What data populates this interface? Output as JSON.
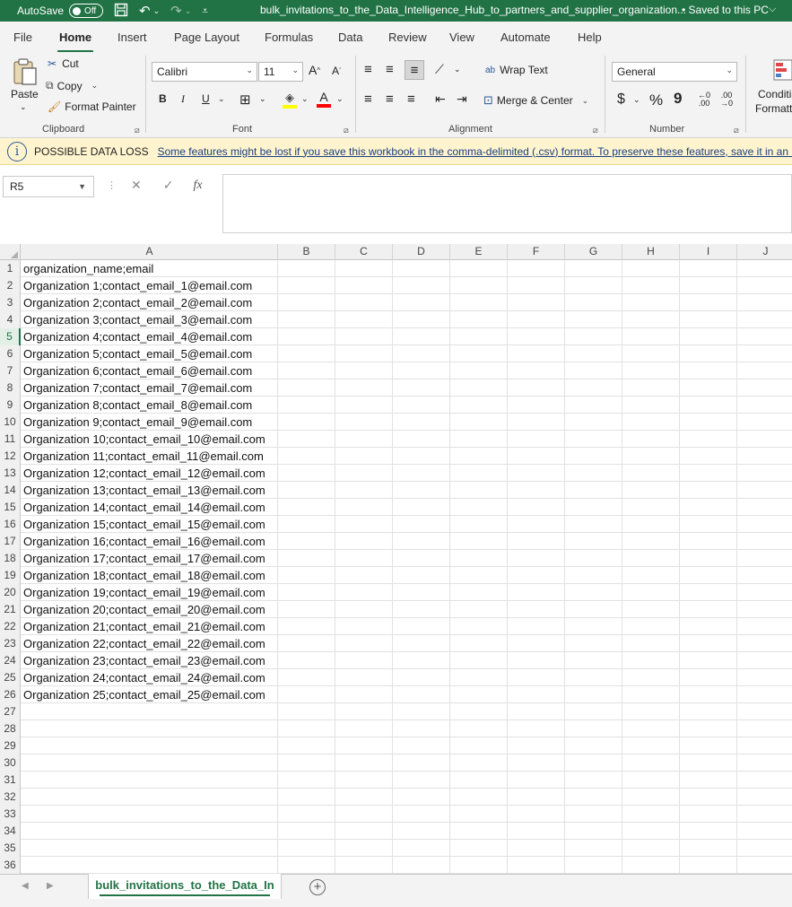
{
  "titlebar": {
    "autosave_label": "AutoSave",
    "autosave_state": "Off",
    "document_title": "bulk_invitations_to_the_Data_Intelligence_Hub_to_partners_and_supplier_organization...",
    "save_status": "• Saved to this PC"
  },
  "menu": {
    "tabs": [
      "File",
      "Home",
      "Insert",
      "Page Layout",
      "Formulas",
      "Data",
      "Review",
      "View",
      "Automate",
      "Help"
    ],
    "active": "Home"
  },
  "ribbon": {
    "clipboard": {
      "paste": "Paste",
      "cut": "Cut",
      "copy": "Copy",
      "format_painter": "Format Painter",
      "label": "Clipboard"
    },
    "font": {
      "family": "Calibri",
      "size": "11",
      "bold": "B",
      "italic": "I",
      "underline": "U",
      "label": "Font"
    },
    "alignment": {
      "wrap_text": "Wrap Text",
      "merge_center": "Merge & Center",
      "label": "Alignment"
    },
    "number": {
      "format": "General",
      "currency": "$",
      "percent": "%",
      "comma": "9",
      "label": "Number"
    },
    "styles": {
      "conditional_line1": "Conditi",
      "conditional_line2": "Formatt"
    }
  },
  "infobar": {
    "title": "POSSIBLE DATA LOSS",
    "message": "Some features might be lost if you save this workbook in the comma-delimited (.csv) format. To preserve these features, save it in an Exc"
  },
  "formula_bar": {
    "name_box": "R5",
    "fx": "fx",
    "value": ""
  },
  "grid": {
    "columns": [
      "A",
      "B",
      "C",
      "D",
      "E",
      "F",
      "G",
      "H",
      "I",
      "J"
    ],
    "row_numbers": [
      "1",
      "2",
      "3",
      "4",
      "5",
      "6",
      "7",
      "8",
      "9",
      "10",
      "11",
      "12",
      "13",
      "14",
      "15",
      "16",
      "17",
      "18",
      "19",
      "20",
      "21",
      "22",
      "23",
      "24",
      "25",
      "26",
      "27",
      "28",
      "29",
      "30",
      "31",
      "32",
      "33",
      "34",
      "35",
      "36"
    ],
    "active_row": "5",
    "cells_A": [
      "organization_name;email",
      "Organization 1;contact_email_1@email.com",
      "Organization 2;contact_email_2@email.com",
      "Organization 3;contact_email_3@email.com",
      "Organization 4;contact_email_4@email.com",
      "Organization 5;contact_email_5@email.com",
      "Organization 6;contact_email_6@email.com",
      "Organization 7;contact_email_7@email.com",
      "Organization 8;contact_email_8@email.com",
      "Organization 9;contact_email_9@email.com",
      "Organization 10;contact_email_10@email.com",
      "Organization 11;contact_email_11@email.com",
      "Organization 12;contact_email_12@email.com",
      "Organization 13;contact_email_13@email.com",
      "Organization 14;contact_email_14@email.com",
      "Organization 15;contact_email_15@email.com",
      "Organization 16;contact_email_16@email.com",
      "Organization 17;contact_email_17@email.com",
      "Organization 18;contact_email_18@email.com",
      "Organization 19;contact_email_19@email.com",
      "Organization 20;contact_email_20@email.com",
      "Organization 21;contact_email_21@email.com",
      "Organization 22;contact_email_22@email.com",
      "Organization 23;contact_email_23@email.com",
      "Organization 24;contact_email_24@email.com",
      "Organization 25;contact_email_25@email.com",
      "",
      "",
      "",
      "",
      "",
      "",
      "",
      "",
      "",
      ""
    ]
  },
  "sheets": {
    "active_tab": "bulk_invitations_to_the_Data_In",
    "add_symbol": "+"
  },
  "colors": {
    "excel_green": "#217346",
    "info_bar": "#fff4ce",
    "highlight_yellow": "#ffff00",
    "font_red": "#ff0000"
  }
}
